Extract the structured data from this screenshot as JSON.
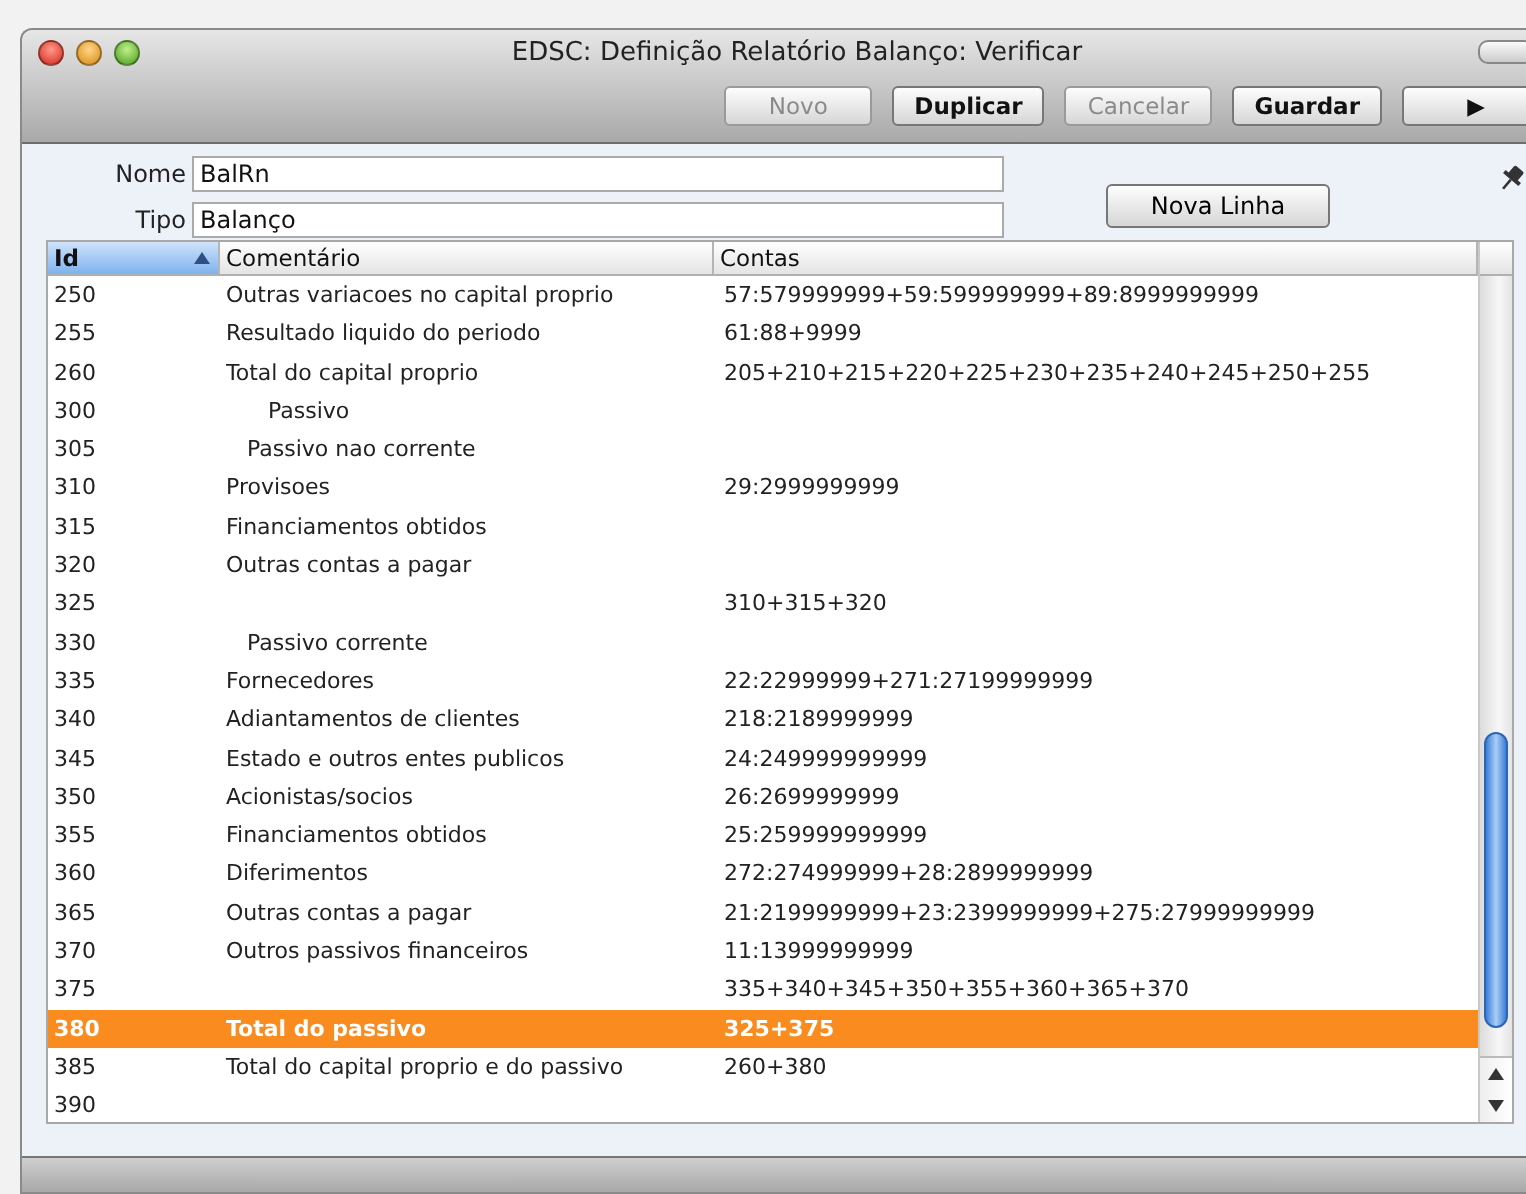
{
  "window": {
    "title": "EDSC: Definição Relatório Balanço: Verificar"
  },
  "toolbar": {
    "buttons": [
      {
        "label": "Novo",
        "disabled": true
      },
      {
        "label": "Duplicar",
        "disabled": false
      },
      {
        "label": "Cancelar",
        "disabled": true
      },
      {
        "label": "Guardar",
        "disabled": false
      },
      {
        "label": "▶",
        "disabled": false
      }
    ]
  },
  "form": {
    "fields": [
      {
        "label": "Nome",
        "value": "BalRn"
      },
      {
        "label": "Tipo",
        "value": "Balanço"
      }
    ],
    "button": "Nova Linha"
  },
  "table": {
    "columns": [
      {
        "label": "Id",
        "selected": true
      },
      {
        "label": "Comentário",
        "selected": false
      },
      {
        "label": "Contas",
        "selected": false
      }
    ],
    "rows": [
      {
        "id": "250",
        "comment": "Outras variacoes no capital proprio",
        "accounts": "57:579999999+59:599999999+89:8999999999",
        "selected": false
      },
      {
        "id": "255",
        "comment": "Resultado liquido do periodo",
        "accounts": "61:88+9999",
        "selected": false
      },
      {
        "id": "260",
        "comment": "Total do capital proprio",
        "accounts": "205+210+215+220+225+230+235+240+245+250+255",
        "selected": false
      },
      {
        "id": "300",
        "comment": "      Passivo",
        "accounts": "",
        "selected": false
      },
      {
        "id": "305",
        "comment": "   Passivo nao corrente",
        "accounts": "",
        "selected": false
      },
      {
        "id": "310",
        "comment": "Provisoes",
        "accounts": "29:2999999999",
        "selected": false
      },
      {
        "id": "315",
        "comment": "Financiamentos obtidos",
        "accounts": "",
        "selected": false
      },
      {
        "id": "320",
        "comment": "Outras contas a pagar",
        "accounts": "",
        "selected": false
      },
      {
        "id": "325",
        "comment": "",
        "accounts": "310+315+320",
        "selected": false
      },
      {
        "id": "330",
        "comment": "   Passivo corrente",
        "accounts": "",
        "selected": false
      },
      {
        "id": "335",
        "comment": "Fornecedores",
        "accounts": "22:22999999+271:27199999999",
        "selected": false
      },
      {
        "id": "340",
        "comment": "Adiantamentos de clientes",
        "accounts": "218:2189999999",
        "selected": false
      },
      {
        "id": "345",
        "comment": "Estado e outros entes publicos",
        "accounts": "24:249999999999",
        "selected": false
      },
      {
        "id": "350",
        "comment": "Acionistas/socios",
        "accounts": "26:2699999999",
        "selected": false
      },
      {
        "id": "355",
        "comment": "Financiamentos obtidos",
        "accounts": "25:259999999999",
        "selected": false
      },
      {
        "id": "360",
        "comment": "Diferimentos",
        "accounts": "272:274999999+28:2899999999",
        "selected": false
      },
      {
        "id": "365",
        "comment": "Outras contas a pagar",
        "accounts": "21:2199999999+23:2399999999+275:27999999999",
        "selected": false
      },
      {
        "id": "370",
        "comment": "Outros passivos financeiros",
        "accounts": "11:13999999999",
        "selected": false
      },
      {
        "id": "375",
        "comment": "",
        "accounts": "335+340+345+350+355+360+365+370",
        "selected": false
      },
      {
        "id": "380",
        "comment": "Total do passivo",
        "accounts": "325+375",
        "selected": true
      },
      {
        "id": "385",
        "comment": "Total do capital proprio e do passivo",
        "accounts": "260+380",
        "selected": false
      },
      {
        "id": "390",
        "comment": "",
        "accounts": "",
        "selected": false
      }
    ]
  }
}
